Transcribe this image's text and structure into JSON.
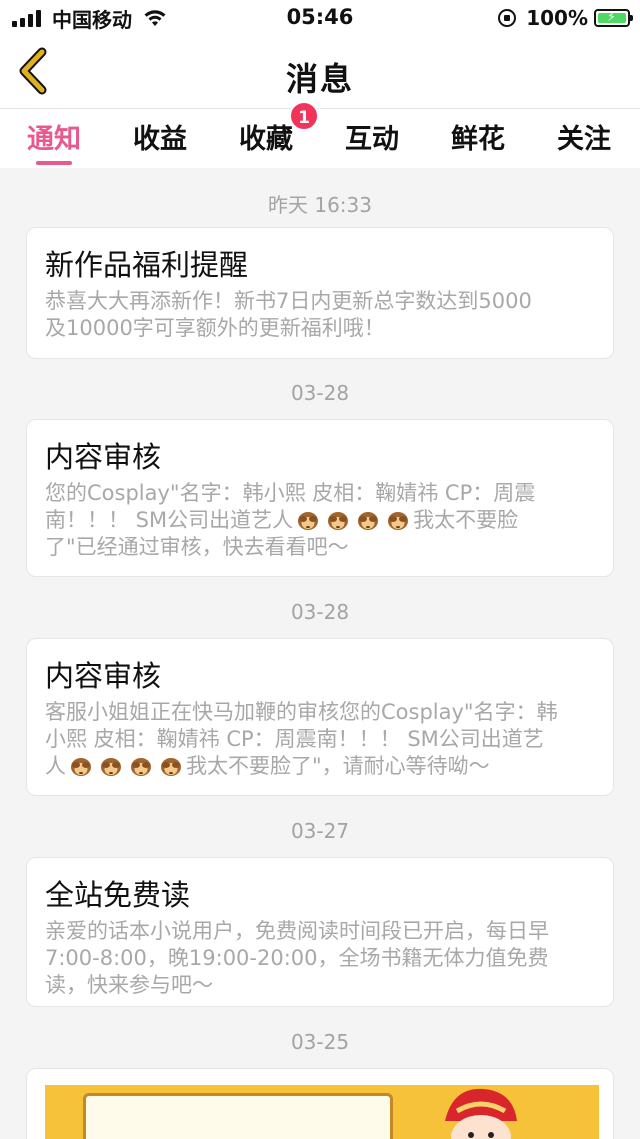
{
  "status_bar": {
    "carrier": "中国移动",
    "time": "05:46",
    "battery": "100%"
  },
  "nav": {
    "title": "消息"
  },
  "tabs": [
    {
      "label": "通知",
      "active": true
    },
    {
      "label": "收益",
      "active": false
    },
    {
      "label": "收藏",
      "active": false,
      "badge": "1"
    },
    {
      "label": "互动",
      "active": false
    },
    {
      "label": "鲜花",
      "active": false
    },
    {
      "label": "关注",
      "active": false
    }
  ],
  "messages": [
    {
      "date": "昨天 16:33",
      "title": "新作品福利提醒",
      "body": [
        "恭喜大大再添新作！新书7日内更新总字数达到5000",
        "及10000字可享额外的更新福利哦！"
      ]
    },
    {
      "date": "03-28",
      "title": "内容审核",
      "body_a": "您的Cosplay\"名字：韩小熙 皮相：鞠婧祎 CP：周震",
      "body_b": "南！！！ SM公司出道艺人",
      "body_c": "我太不要脸",
      "body_d": "了\"已经通过审核，快去看看吧～"
    },
    {
      "date": "03-28",
      "title": "内容审核",
      "body_a": "客服小姐姐正在快马加鞭的审核您的Cosplay\"名字：韩",
      "body_b": "小熙 皮相：鞠婧祎 CP：周震南！！！ SM公司出道艺",
      "body_c": "人",
      "body_d": "我太不要脸了\"，请耐心等待呦～"
    },
    {
      "date": "03-27",
      "title": "全站免费读",
      "body": [
        "亲爱的话本小说用户，免费阅读时间段已开启，每日早",
        "7:00-8:00，晚19:00-20:00，全场书籍无体力值免费",
        "读，快来参与吧～"
      ]
    },
    {
      "date": "03-25"
    }
  ],
  "colors": {
    "accent": "#e85a8f",
    "badge": "#f2345b",
    "back_arrow": "#e0b020",
    "muted_text": "#a8a8a8"
  },
  "icons": {
    "back": "chevron-left-icon",
    "emoji": "see-no-evil-monkey-icon"
  }
}
